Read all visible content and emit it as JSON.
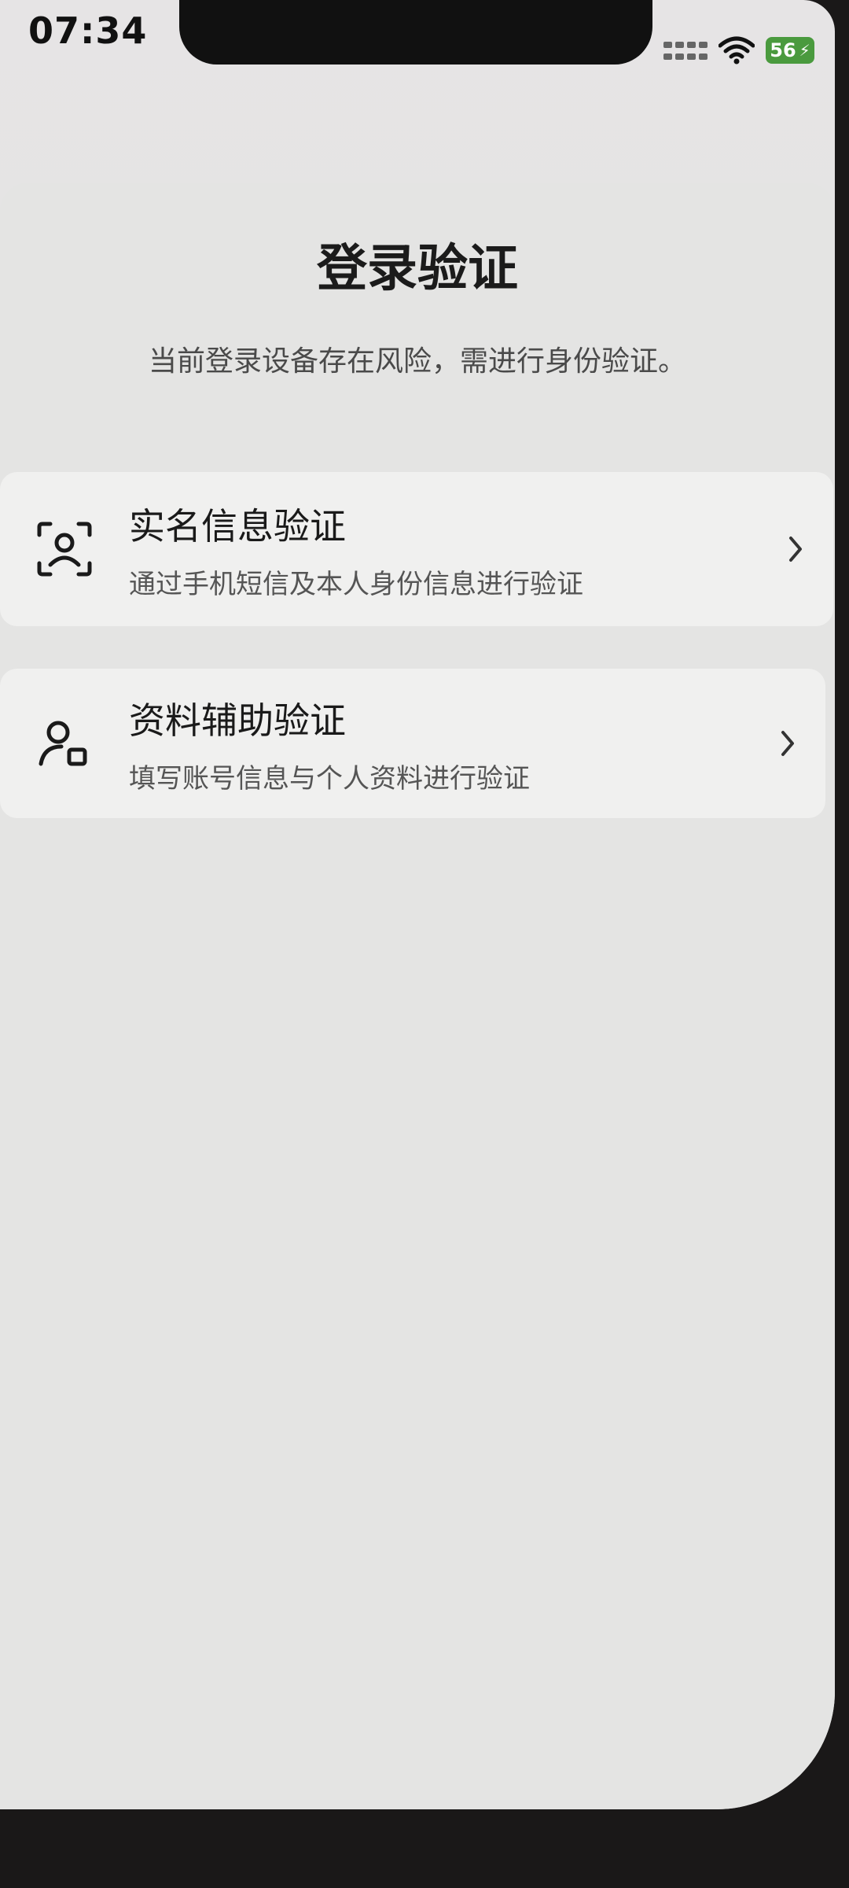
{
  "status_bar": {
    "time": "07:34",
    "battery": "56",
    "icons": [
      "signal-icon",
      "wifi-icon",
      "battery-icon",
      "charging-icon"
    ]
  },
  "page": {
    "title": "登录验证",
    "subtitle": "当前登录设备存在风险，需进行身份验证。"
  },
  "options": [
    {
      "title": "实名信息验证",
      "description": "通过手机短信及本人身份信息进行验证",
      "icon": "face-scan-icon"
    },
    {
      "title": "资料辅助验证",
      "description": "填写账号信息与个人资料进行验证",
      "icon": "user-profile-icon"
    }
  ],
  "colors": {
    "battery": "#4a9a3e",
    "card_background": "#f0f0ef",
    "page_background": "#e4e4e3"
  }
}
